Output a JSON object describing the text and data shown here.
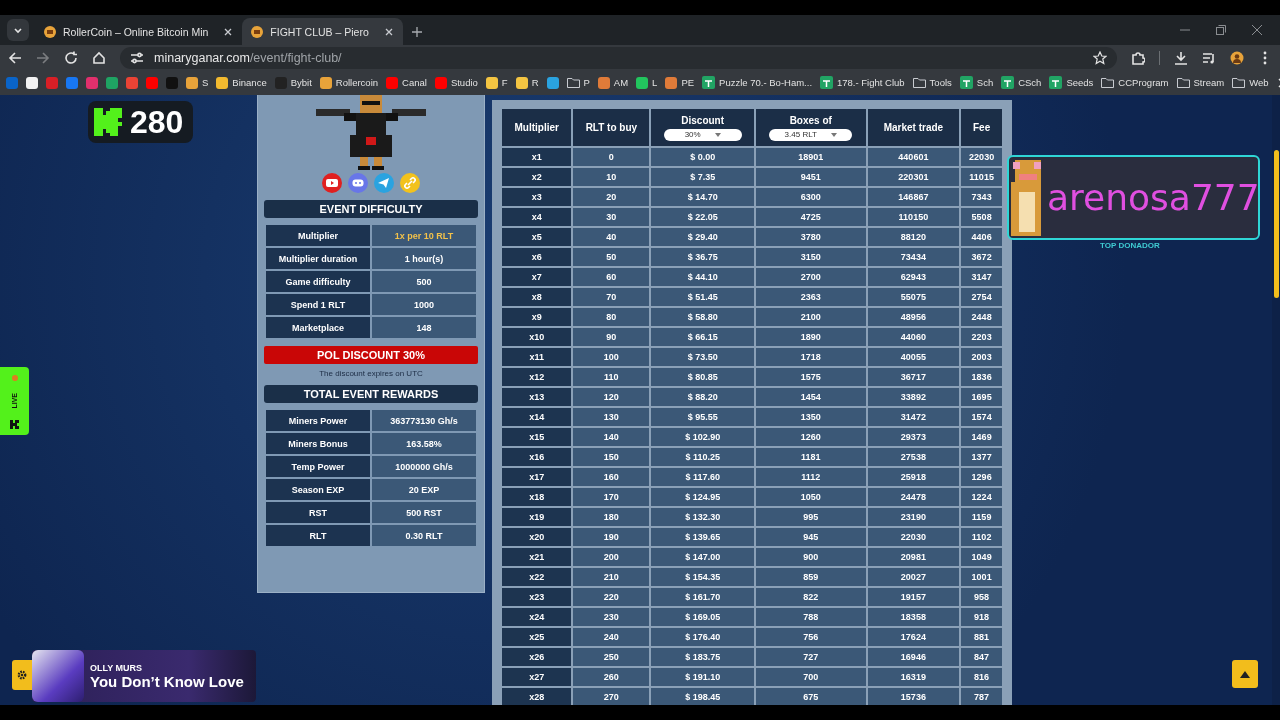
{
  "browser": {
    "tabs": [
      {
        "title": "RollerCoin – Online Bitcoin Min",
        "selected": false
      },
      {
        "title": "FIGHT CLUB – Piero",
        "selected": true
      }
    ],
    "url": {
      "domain": "minaryganar.com",
      "path": "/event/fight-club/"
    },
    "forward_disabled": true,
    "bookmarks": [
      {
        "kind": "site",
        "color": "#0a64c8"
      },
      {
        "kind": "site",
        "color": "#f2f2f2"
      },
      {
        "kind": "site",
        "color": "#d81f26"
      },
      {
        "kind": "site",
        "color": "#1877f2"
      },
      {
        "kind": "site",
        "color": "#e1306c"
      },
      {
        "kind": "site",
        "color": "#1fa463"
      },
      {
        "kind": "site",
        "color": "#ea4335"
      },
      {
        "kind": "site",
        "color": "#ff0000"
      },
      {
        "kind": "site",
        "color": "#111111"
      },
      {
        "kind": "site",
        "color": "#e8a33a",
        "label": "S"
      },
      {
        "kind": "site",
        "color": "#f3ba2f",
        "label": "Binance"
      },
      {
        "kind": "site",
        "color": "#222222",
        "label": "Bybit"
      },
      {
        "kind": "site",
        "color": "#e8a33a",
        "label": "Rollercoin"
      },
      {
        "kind": "site",
        "color": "#ff0000",
        "label": "Canal"
      },
      {
        "kind": "site",
        "color": "#ff0000",
        "label": "Studio"
      },
      {
        "kind": "site",
        "color": "#f4c542",
        "label": "F"
      },
      {
        "kind": "site",
        "color": "#f4c542",
        "label": "R"
      },
      {
        "kind": "site",
        "color": "#2aa3e0"
      },
      {
        "kind": "folder",
        "label": "P"
      },
      {
        "kind": "site",
        "color": "#e07b39",
        "label": "AM"
      },
      {
        "kind": "site",
        "color": "#22c55e",
        "label": "L"
      },
      {
        "kind": "site",
        "color": "#e07b39",
        "label": "PE"
      },
      {
        "kind": "sheet",
        "label": "Puzzle 70.- Bo-Ham..."
      },
      {
        "kind": "sheet",
        "label": "178.- Fight Club"
      },
      {
        "kind": "folder",
        "label": "Tools"
      },
      {
        "kind": "sheet",
        "label": "Sch"
      },
      {
        "kind": "sheet",
        "label": "CSch"
      },
      {
        "kind": "sheet",
        "label": "Seeds"
      },
      {
        "kind": "folder",
        "label": "CCProgram"
      },
      {
        "kind": "folder",
        "label": "Stream"
      },
      {
        "kind": "folder",
        "label": "Web"
      }
    ]
  },
  "page": {
    "kick_badge": {
      "count": "280"
    },
    "live_tab": {
      "label": "LIVE"
    },
    "event_difficulty": {
      "title": "EVENT DIFFICULTY",
      "rows": [
        {
          "label": "Multiplier",
          "value": "1x per 10 RLT",
          "highlight": true
        },
        {
          "label": "Multiplier duration",
          "value": "1 hour(s)",
          "highlight": false
        },
        {
          "label": "Game difficulty",
          "value": "500",
          "highlight": false
        },
        {
          "label": "Spend 1 RLT",
          "value": "1000",
          "highlight": false
        },
        {
          "label": "Marketplace",
          "value": "148",
          "highlight": false
        }
      ]
    },
    "discount_banner": {
      "title": "POL DISCOUNT 30%",
      "note": "The discount expires on UTC"
    },
    "total_event_rewards": {
      "title": "TOTAL EVENT REWARDS",
      "rows": [
        {
          "label": "Miners Power",
          "value": "363773130 Gh/s"
        },
        {
          "label": "Miners Bonus",
          "value": "163.58%"
        },
        {
          "label": "Temp Power",
          "value": "1000000 Gh/s"
        },
        {
          "label": "Season EXP",
          "value": "20 EXP"
        },
        {
          "label": "RST",
          "value": "500 RST"
        },
        {
          "label": "RLT",
          "value": "0.30 RLT"
        }
      ]
    },
    "multiplier_table": {
      "columns": [
        {
          "label": "Multiplier"
        },
        {
          "label": "RLT to buy"
        },
        {
          "label": "Discount",
          "dropdown": "30%"
        },
        {
          "label": "Boxes of",
          "dropdown": "3.45 RLT"
        },
        {
          "label": "Market trade"
        },
        {
          "label": "Fee"
        }
      ],
      "rows": [
        [
          "x1",
          "0",
          "$ 0.00",
          "18901",
          "440601",
          "22030"
        ],
        [
          "x2",
          "10",
          "$ 7.35",
          "9451",
          "220301",
          "11015"
        ],
        [
          "x3",
          "20",
          "$ 14.70",
          "6300",
          "146867",
          "7343"
        ],
        [
          "x4",
          "30",
          "$ 22.05",
          "4725",
          "110150",
          "5508"
        ],
        [
          "x5",
          "40",
          "$ 29.40",
          "3780",
          "88120",
          "4406"
        ],
        [
          "x6",
          "50",
          "$ 36.75",
          "3150",
          "73434",
          "3672"
        ],
        [
          "x7",
          "60",
          "$ 44.10",
          "2700",
          "62943",
          "3147"
        ],
        [
          "x8",
          "70",
          "$ 51.45",
          "2363",
          "55075",
          "2754"
        ],
        [
          "x9",
          "80",
          "$ 58.80",
          "2100",
          "48956",
          "2448"
        ],
        [
          "x10",
          "90",
          "$ 66.15",
          "1890",
          "44060",
          "2203"
        ],
        [
          "x11",
          "100",
          "$ 73.50",
          "1718",
          "40055",
          "2003"
        ],
        [
          "x12",
          "110",
          "$ 80.85",
          "1575",
          "36717",
          "1836"
        ],
        [
          "x13",
          "120",
          "$ 88.20",
          "1454",
          "33892",
          "1695"
        ],
        [
          "x14",
          "130",
          "$ 95.55",
          "1350",
          "31472",
          "1574"
        ],
        [
          "x15",
          "140",
          "$ 102.90",
          "1260",
          "29373",
          "1469"
        ],
        [
          "x16",
          "150",
          "$ 110.25",
          "1181",
          "27538",
          "1377"
        ],
        [
          "x17",
          "160",
          "$ 117.60",
          "1112",
          "25918",
          "1296"
        ],
        [
          "x18",
          "170",
          "$ 124.95",
          "1050",
          "24478",
          "1224"
        ],
        [
          "x19",
          "180",
          "$ 132.30",
          "995",
          "23190",
          "1159"
        ],
        [
          "x20",
          "190",
          "$ 139.65",
          "945",
          "22030",
          "1102"
        ],
        [
          "x21",
          "200",
          "$ 147.00",
          "900",
          "20981",
          "1049"
        ],
        [
          "x22",
          "210",
          "$ 154.35",
          "859",
          "20027",
          "1001"
        ],
        [
          "x23",
          "220",
          "$ 161.70",
          "822",
          "19157",
          "958"
        ],
        [
          "x24",
          "230",
          "$ 169.05",
          "788",
          "18358",
          "918"
        ],
        [
          "x25",
          "240",
          "$ 176.40",
          "756",
          "17624",
          "881"
        ],
        [
          "x26",
          "250",
          "$ 183.75",
          "727",
          "16946",
          "847"
        ],
        [
          "x27",
          "260",
          "$ 191.10",
          "700",
          "16319",
          "816"
        ],
        [
          "x28",
          "270",
          "$ 198.45",
          "675",
          "15736",
          "787"
        ]
      ]
    },
    "donor": {
      "name": "arenosa777",
      "caption": "TOP DONADOR"
    },
    "now_playing": {
      "artist": "OLLY MURS",
      "title": "You Don’t Know Love"
    }
  }
}
